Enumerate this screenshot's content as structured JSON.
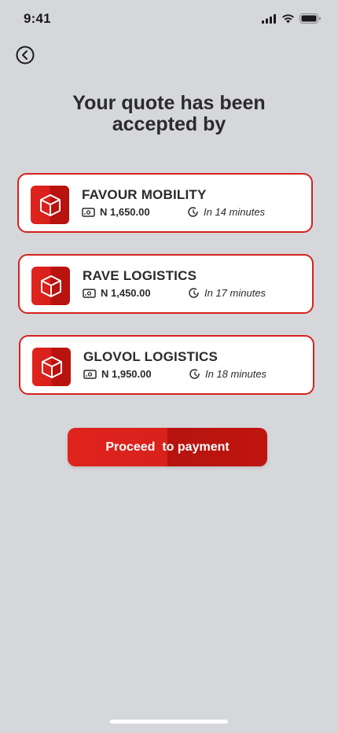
{
  "status_bar": {
    "time": "9:41",
    "icons": [
      "signal-icon",
      "wifi-icon",
      "battery-icon"
    ]
  },
  "header": {
    "back_icon": "back-arrow-circle-icon",
    "title_line1": "Your quote has been",
    "title_line2": "accepted by"
  },
  "quotes": [
    {
      "name": "FAVOUR MOBILITY",
      "price": "N 1,650.00",
      "eta": "In 14 minutes"
    },
    {
      "name": "RAVE LOGISTICS",
      "price": "N 1,450.00",
      "eta": "In 17 minutes"
    },
    {
      "name": "GLOVOL LOGISTICS",
      "price": "N 1,950.00",
      "eta": "In 18 minutes"
    }
  ],
  "actions": {
    "proceed_label": "Proceed  to payment"
  },
  "colors": {
    "accent": "#d4221d",
    "accent_dark": "#b9130f",
    "background": "#d6d7db",
    "card": "#ffffff"
  }
}
